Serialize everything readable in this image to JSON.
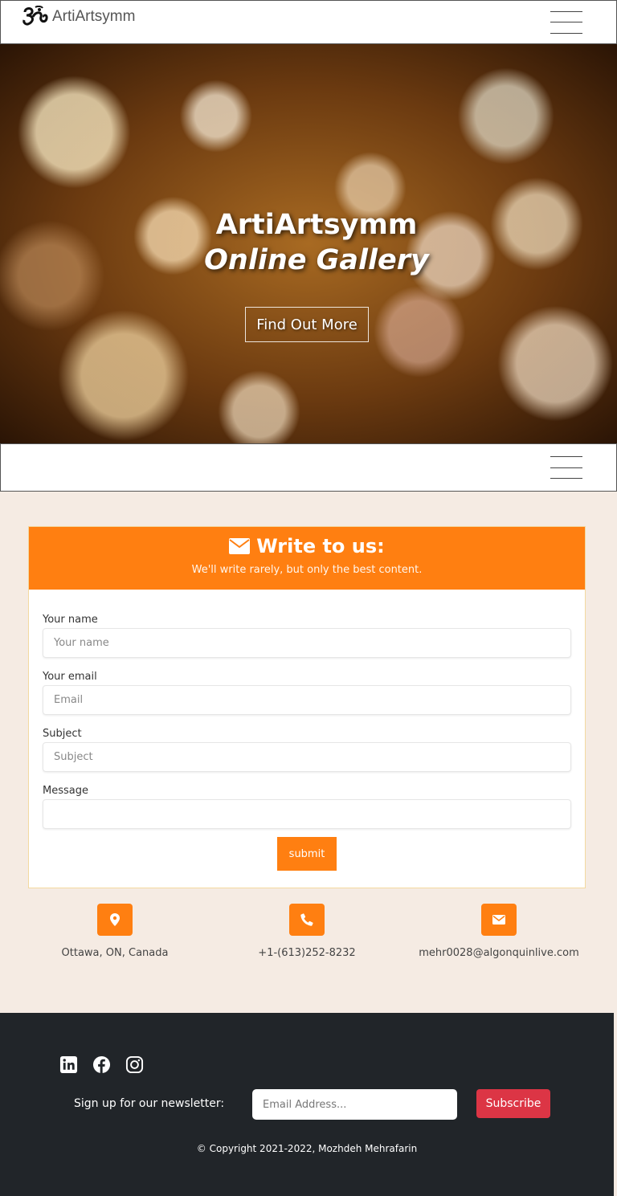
{
  "header": {
    "brand_name": "ArtiArtsymm",
    "logo_icon": "om-symbol-logo",
    "menu_icon": "hamburger-icon"
  },
  "hero": {
    "title": "ArtiArtsymm",
    "subtitle": "Online Gallery",
    "button_label": "Find Out More"
  },
  "secondary_nav": {
    "menu_icon": "hamburger-icon"
  },
  "contact_form": {
    "title": "Write to us:",
    "title_icon": "envelope-icon",
    "subtitle": "We'll write rarely, but only the best content.",
    "fields": {
      "name": {
        "label": "Your name",
        "placeholder": "Your name",
        "value": ""
      },
      "email": {
        "label": "Your email",
        "placeholder": "Email",
        "value": ""
      },
      "subject": {
        "label": "Subject",
        "placeholder": "Subject",
        "value": ""
      },
      "message": {
        "label": "Message",
        "placeholder": "",
        "value": ""
      }
    },
    "submit_label": "submit",
    "accent_color": "#ff7f11"
  },
  "contact_info": [
    {
      "icon": "map-marker-icon",
      "text": "Ottawa, ON, Canada"
    },
    {
      "icon": "phone-icon",
      "text": "+1-(613)252-8232"
    },
    {
      "icon": "envelope-icon",
      "text": "mehr0028@algonquinlive.com"
    }
  ],
  "footer": {
    "social": [
      "linkedin-icon",
      "facebook-icon",
      "instagram-icon"
    ],
    "newsletter_label": "Sign up for our newsletter:",
    "newsletter_placeholder": "Email Address...",
    "subscribe_label": "Subscribe",
    "copyright": "© Copyright 2021-2022, Mozhdeh Mehrafarin",
    "background": "#212529",
    "subscribe_color": "#dc3545"
  }
}
